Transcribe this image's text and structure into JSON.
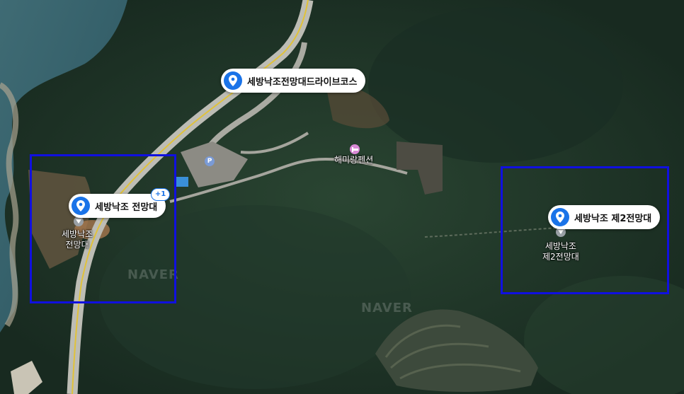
{
  "markers": [
    {
      "label": "세방낙조전망대드라이브코스"
    },
    {
      "label": "세방낙조 전망대",
      "badge": "+1"
    },
    {
      "label": "세방낙조 제2전망대"
    }
  ],
  "places": {
    "observatory1": {
      "line1": "세방낙조",
      "line2": "전망대"
    },
    "observatory2": {
      "line1": "세방낙조",
      "line2": "제2전망대"
    },
    "pension": {
      "label": "해미랑펜션"
    }
  },
  "parking": {
    "icon": "parking-icon",
    "glyph": "P"
  },
  "watermark": "NAVER",
  "colors": {
    "marker_blue": "#1a73e8",
    "selection_box": "#1010e0",
    "pension_icon": "#d98ad6",
    "parking_icon": "#7a9bd6"
  }
}
